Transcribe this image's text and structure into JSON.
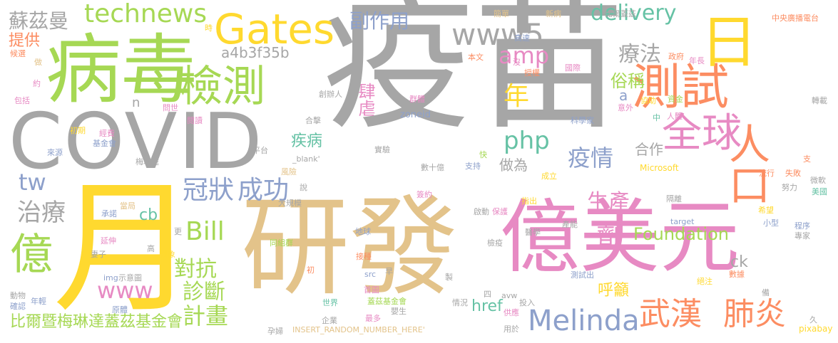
{
  "words": [
    {
      "text": "疫苗",
      "color": "#a6a6a6"
    },
    {
      "text": "研發",
      "color": "#e3c38a"
    },
    {
      "text": "億美元",
      "color": "#e78ac3"
    },
    {
      "text": "病毒",
      "color": "#a6d854"
    },
    {
      "text": "COVID",
      "color": "#a6a6a6"
    },
    {
      "text": "月",
      "color": "#ffd92f"
    },
    {
      "text": "測試",
      "color": "#fc8d62"
    },
    {
      "text": "日",
      "color": "#ffd92f"
    },
    {
      "text": "全球",
      "color": "#e78ac3"
    },
    {
      "text": "人口",
      "color": "#fc8d62"
    },
    {
      "text": "Gates",
      "color": "#ffd92f"
    },
    {
      "text": "檢測",
      "color": "#a6d854"
    },
    {
      "text": "Melinda",
      "color": "#8da0cb"
    },
    {
      "text": "武漢",
      "color": "#fc8d62"
    },
    {
      "text": "肺炎",
      "color": "#fc8d62"
    },
    {
      "text": "億",
      "color": "#a6d854"
    },
    {
      "text": "www5",
      "color": "#a6a6a6"
    },
    {
      "text": "delivery",
      "color": "#66c2a5"
    },
    {
      "text": "technews",
      "color": "#a6d854"
    },
    {
      "text": "冠狀",
      "color": "#8da0cb"
    },
    {
      "text": "成功",
      "color": "#8da0cb"
    },
    {
      "text": "amp",
      "color": "#e78ac3"
    },
    {
      "text": "療法",
      "color": "#a6a6a6"
    },
    {
      "text": "Bill",
      "color": "#a6d854"
    },
    {
      "text": "治療",
      "color": "#a6a6a6"
    },
    {
      "text": "生產",
      "color": "#e78ac3"
    },
    {
      "text": "劑",
      "color": "#e78ac3"
    },
    {
      "text": "年",
      "color": "#ffd92f"
    },
    {
      "text": "php",
      "color": "#66c2a5"
    },
    {
      "text": "疫情",
      "color": "#8da0cb"
    },
    {
      "text": "對抗",
      "color": "#a6d854"
    },
    {
      "text": "計畫",
      "color": "#a6d854"
    },
    {
      "text": "診斷",
      "color": "#a6d854"
    },
    {
      "text": "www",
      "color": "#e78ac3"
    },
    {
      "text": "tw",
      "color": "#8da0cb"
    },
    {
      "text": "Foundation",
      "color": "#a6d854"
    },
    {
      "text": "蘇茲曼",
      "color": "#a6a6a6"
    },
    {
      "text": "副作用",
      "color": "#8da0cb"
    },
    {
      "text": "a4b3f35b",
      "color": "#a6a6a6"
    },
    {
      "text": "提供",
      "color": "#fc8d62"
    },
    {
      "text": "俗稱",
      "color": "#a6d854"
    },
    {
      "text": "比爾暨梅琳達蓋茲基金會",
      "color": "#a6d854"
    },
    {
      "text": "疾病",
      "color": "#66c2a5"
    },
    {
      "text": "合作",
      "color": "#a6a6a6"
    },
    {
      "text": "做為",
      "color": "#a6a6a6"
    },
    {
      "text": "肆虐",
      "color": "#e78ac3"
    },
    {
      "text": "呼籲",
      "color": "#ffd92f"
    },
    {
      "text": "href",
      "color": "#66c2a5"
    },
    {
      "text": "ck",
      "color": "#a6a6a6"
    },
    {
      "text": "cb",
      "color": "#66c2a5"
    },
    {
      "text": "a",
      "color": "#8da0cb"
    },
    {
      "text": "n",
      "color": "#a6a6a6"
    },
    {
      "text": "INSERT_RANDOM_NUMBER_HERE'",
      "color": "#e3c38a"
    },
    {
      "text": "Microsoft",
      "color": "#ffd92f"
    },
    {
      "text": "zoneid",
      "color": "#8da0cb"
    },
    {
      "text": "_blank'",
      "color": "#a6a6a6"
    },
    {
      "text": "pixabay",
      "color": "#ffd92f"
    },
    {
      "text": "target",
      "color": "#8da0cb"
    },
    {
      "text": "avw",
      "color": "#a6a6a6"
    },
    {
      "text": "src",
      "color": "#8da0cb"
    },
    {
      "text": "img",
      "color": "#8da0cb"
    },
    {
      "text": "基金會",
      "color": "#8da0cb"
    },
    {
      "text": "科學家",
      "color": "#8da0cb"
    },
    {
      "text": "蓋茲基金會",
      "color": "#a6d854"
    },
    {
      "text": "中央廣播電台",
      "color": "#fc8d62"
    },
    {
      "text": "比爾蓋茲",
      "color": "#a6a6a6"
    },
    {
      "text": "創辦人",
      "color": "#a6a6a6"
    },
    {
      "text": "來源",
      "color": "#8da0cb"
    },
    {
      "text": "包括",
      "color": "#e78ac3"
    },
    {
      "text": "經費",
      "color": "#e78ac3"
    },
    {
      "text": "初期",
      "color": "#ffd92f"
    },
    {
      "text": "問世",
      "color": "#e78ac3"
    },
    {
      "text": "閱讀",
      "color": "#e78ac3"
    },
    {
      "text": "合擊",
      "color": "#a6a6a6"
    },
    {
      "text": "平台",
      "color": "#a6a6a6"
    },
    {
      "text": "實驗",
      "color": "#a6a6a6"
    },
    {
      "text": "數十億",
      "color": "#a6a6a6"
    },
    {
      "text": "簽約",
      "color": "#e78ac3"
    },
    {
      "text": "支持",
      "color": "#8da0cb"
    },
    {
      "text": "成立",
      "color": "#ffd92f"
    },
    {
      "text": "協助",
      "color": "#ffd92f"
    },
    {
      "text": "意外",
      "color": "#e78ac3"
    },
    {
      "text": "人體",
      "color": "#e78ac3"
    },
    {
      "text": "資金",
      "color": "#a6d854"
    },
    {
      "text": "隔離",
      "color": "#a6a6a6"
    },
    {
      "text": "流行",
      "color": "#fc8d62"
    },
    {
      "text": "失敗",
      "color": "#fc8d62"
    },
    {
      "text": "微軟",
      "color": "#a6a6a6"
    },
    {
      "text": "美國",
      "color": "#66c2a5"
    },
    {
      "text": "努力",
      "color": "#a6a6a6"
    },
    {
      "text": "希望",
      "color": "#ffd92f"
    },
    {
      "text": "小型",
      "color": "#8da0cb"
    },
    {
      "text": "程序",
      "color": "#8da0cb"
    },
    {
      "text": "專家",
      "color": "#a6a6a6"
    },
    {
      "text": "數據",
      "color": "#fc8d62"
    },
    {
      "text": "絕注",
      "color": "#ffd92f"
    },
    {
      "text": "測試出",
      "color": "#8da0cb"
    },
    {
      "text": "產能",
      "color": "#a6a6a6"
    },
    {
      "text": "醫學",
      "color": "#a6a6a6"
    },
    {
      "text": "指出",
      "color": "#ffd92f"
    },
    {
      "text": "保護",
      "color": "#e78ac3"
    },
    {
      "text": "啟動",
      "color": "#a6a6a6"
    },
    {
      "text": "檢疫",
      "color": "#a6a6a6"
    },
    {
      "text": "接種",
      "color": "#fc8d62"
    },
    {
      "text": "首圖",
      "color": "#e78ac3"
    },
    {
      "text": "世界",
      "color": "#66c2a5"
    },
    {
      "text": "企業",
      "color": "#a6a6a6"
    },
    {
      "text": "孕婦",
      "color": "#a6a6a6"
    },
    {
      "text": "最多",
      "color": "#e78ac3"
    },
    {
      "text": "嬰生",
      "color": "#a6a6a6"
    },
    {
      "text": "情況",
      "color": "#a6a6a6"
    },
    {
      "text": "投入",
      "color": "#a6a6a6"
    },
    {
      "text": "供應",
      "color": "#e78ac3"
    },
    {
      "text": "用於",
      "color": "#a6a6a6"
    },
    {
      "text": "地球",
      "color": "#8da0cb"
    },
    {
      "text": "同組群",
      "color": "#a6d854"
    },
    {
      "text": "大規模",
      "color": "#a6a6a6"
    },
    {
      "text": "示意圖",
      "color": "#a6a6a6"
    },
    {
      "text": "動物",
      "color": "#a6a6a6"
    },
    {
      "text": "確認",
      "color": "#8da0cb"
    },
    {
      "text": "年輕",
      "color": "#8da0cb"
    },
    {
      "text": "原體",
      "color": "#8da0cb"
    },
    {
      "text": "妻子",
      "color": "#a6a6a6"
    },
    {
      "text": "延伸",
      "color": "#e78ac3"
    },
    {
      "text": "承諾",
      "color": "#8da0cb"
    },
    {
      "text": "當局",
      "color": "#e3c38a"
    },
    {
      "text": "對象",
      "color": "#ffd92f"
    },
    {
      "text": "梅琳達",
      "color": "#a6a6a6"
    },
    {
      "text": "風險",
      "color": "#e3c38a"
    },
    {
      "text": "候選",
      "color": "#fc8d62"
    },
    {
      "text": "約",
      "color": "#e78ac3"
    },
    {
      "text": "做",
      "color": "#e3c38a"
    },
    {
      "text": "簡單",
      "color": "#e3c38a"
    },
    {
      "text": "新病",
      "color": "#e3c38a"
    },
    {
      "text": "高速",
      "color": "#8da0cb"
    },
    {
      "text": "本文",
      "color": "#fc8d62"
    },
    {
      "text": "政府",
      "color": "#fc8d62"
    },
    {
      "text": "年長",
      "color": "#e78ac3"
    },
    {
      "text": "授權",
      "color": "#fc8d62"
    },
    {
      "text": "國際",
      "color": "#e78ac3"
    },
    {
      "text": "群體",
      "color": "#e78ac3"
    },
    {
      "text": "轉載",
      "color": "#a6a6a6"
    },
    {
      "text": "沒",
      "color": "#e78ac3"
    },
    {
      "text": "支",
      "color": "#fc8d62"
    },
    {
      "text": "時",
      "color": "#ffd92f"
    },
    {
      "text": "快",
      "color": "#a6d854"
    },
    {
      "text": "中",
      "color": "#66c2a5"
    },
    {
      "text": "說",
      "color": "#a6a6a6"
    },
    {
      "text": "更",
      "color": "#a6a6a6"
    },
    {
      "text": "高",
      "color": "#a6a6a6"
    },
    {
      "text": "早",
      "color": "#a6a6a6"
    },
    {
      "text": "製",
      "color": "#a6a6a6"
    },
    {
      "text": "初",
      "color": "#fc8d62"
    },
    {
      "text": "四",
      "color": "#a6a6a6"
    },
    {
      "text": "備",
      "color": "#a6a6a6"
    },
    {
      "text": "久",
      "color": "#a6a6a6"
    }
  ]
}
